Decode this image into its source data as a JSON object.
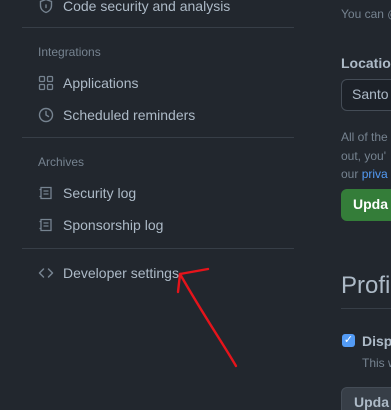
{
  "sidebar": {
    "top_item": {
      "label": "Code security and analysis",
      "icon": "shield-lock-icon"
    },
    "sections": [
      {
        "heading": "Integrations",
        "items": [
          {
            "label": "Applications",
            "icon": "apps-icon"
          },
          {
            "label": "Scheduled reminders",
            "icon": "clock-icon"
          }
        ]
      },
      {
        "heading": "Archives",
        "items": [
          {
            "label": "Security log",
            "icon": "log-icon"
          },
          {
            "label": "Sponsorship log",
            "icon": "log-icon"
          }
        ]
      }
    ],
    "developer": {
      "label": "Developer settings",
      "icon": "code-icon"
    }
  },
  "main": {
    "you_can_text": "You can @",
    "location_label": "Locatio",
    "location_value": "Santo",
    "info_line1": "All of the",
    "info_line2": "out, you'",
    "info_line3_prefix": "our ",
    "info_line3_link": "priva",
    "update_button": "Upda",
    "profile_title": "Profi",
    "display_label": "Displ",
    "display_help": "This w",
    "update_button_2": "Upda"
  },
  "colors": {
    "background": "#22272e",
    "accent_green": "#347d39",
    "link_blue": "#539bf5",
    "annotation_red": "#e5141b"
  }
}
